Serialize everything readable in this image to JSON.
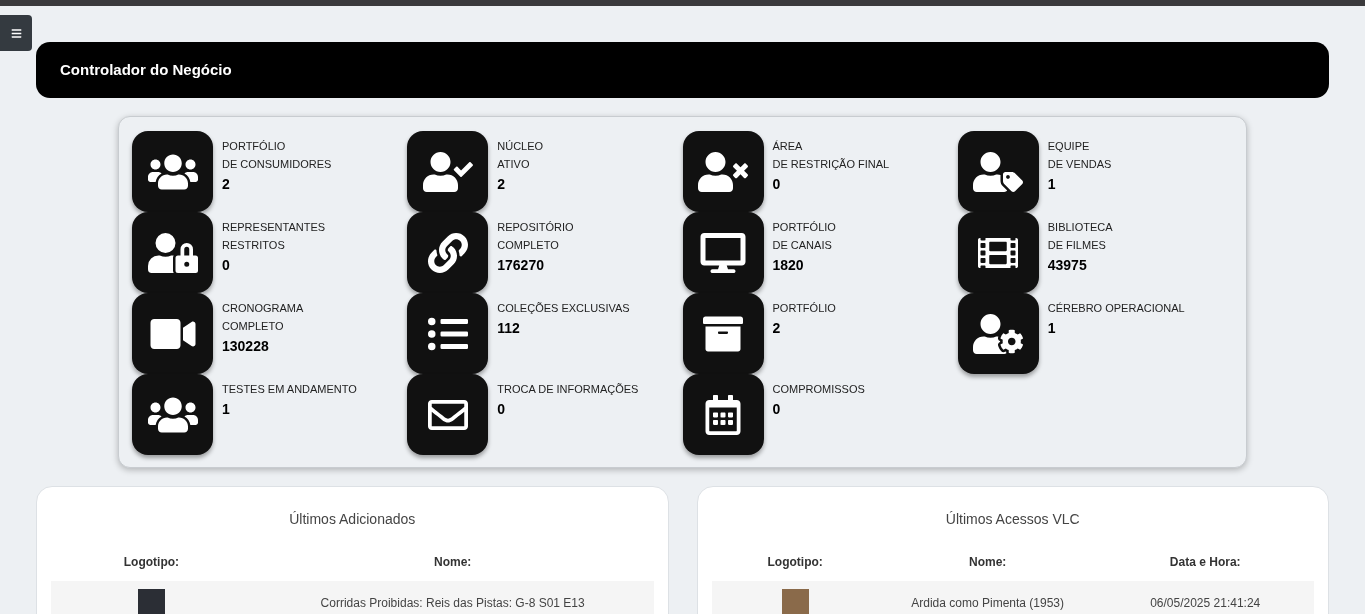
{
  "header": {
    "title": "Controlador do Negócio"
  },
  "stats": [
    {
      "label_lines": [
        "PORTFÓLIO",
        "DE CONSUMIDORES"
      ],
      "value": "2"
    },
    {
      "label_lines": [
        "NÚCLEO",
        "ATIVO"
      ],
      "value": "2"
    },
    {
      "label_lines": [
        "ÁREA",
        "DE RESTRIÇÃO FINAL"
      ],
      "value": "0"
    },
    {
      "label_lines": [
        "EQUIPE",
        "DE VENDAS"
      ],
      "value": "1"
    },
    {
      "label_lines": [
        "REPRESENTANTES",
        "RESTRITOS"
      ],
      "value": "0"
    },
    {
      "label_lines": [
        "REPOSITÓRIO",
        "COMPLETO"
      ],
      "value": "176270"
    },
    {
      "label_lines": [
        "PORTFÓLIO",
        "DE CANAIS"
      ],
      "value": "1820"
    },
    {
      "label_lines": [
        "BIBLIOTECA",
        "DE FILMES"
      ],
      "value": "43975"
    },
    {
      "label_lines": [
        "CRONOGRAMA",
        "COMPLETO"
      ],
      "value": "130228"
    },
    {
      "label_lines": [
        "COLEÇÕES EXCLUSIVAS"
      ],
      "value": "112"
    },
    {
      "label_lines": [
        "PORTFÓLIO"
      ],
      "value": "2"
    },
    {
      "label_lines": [
        "CÉREBRO OPERACIONAL"
      ],
      "value": "1"
    },
    {
      "label_lines": [
        "TESTES EM ANDAMENTO"
      ],
      "value": "1"
    },
    {
      "label_lines": [
        "TROCA DE INFORMAÇÕES"
      ],
      "value": "0"
    },
    {
      "label_lines": [
        "COMPROMISSOS"
      ],
      "value": "0"
    }
  ],
  "panels": [
    {
      "title": "Últimos Adicionados",
      "columns": [
        "Logotipo:",
        "Nome:"
      ],
      "rows": [
        {
          "cells": [
            "",
            "Corridas Proibidas: Reis das Pistas: G-8 S01 E13"
          ]
        }
      ]
    },
    {
      "title": "Últimos Acessos VLC",
      "columns": [
        "Logotipo:",
        "Nome:",
        "Data e Hora:"
      ],
      "rows": [
        {
          "cells": [
            "",
            "Ardida como Pimenta (1953)",
            "06/05/2025 21:41:24"
          ]
        }
      ]
    }
  ]
}
